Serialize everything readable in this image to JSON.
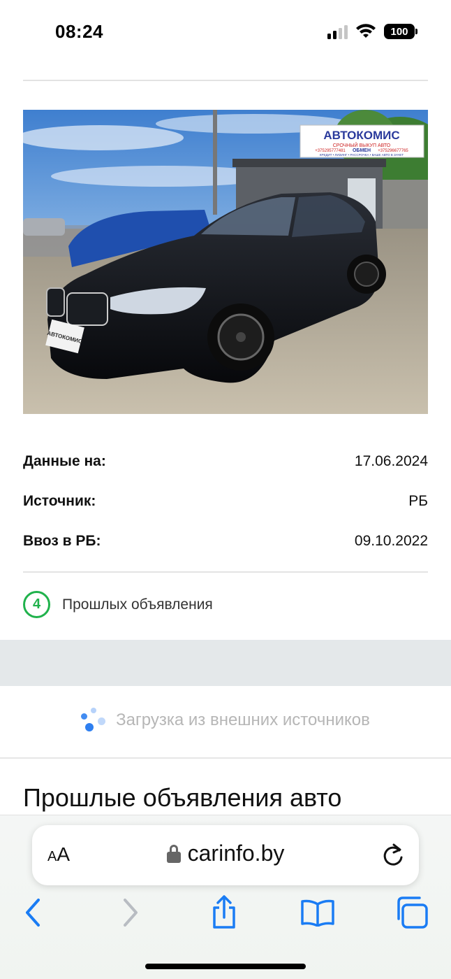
{
  "status_bar": {
    "time": "08:24",
    "battery": "100",
    "icons": [
      "signal-icon",
      "wifi-icon",
      "battery-icon"
    ]
  },
  "photo": {
    "sign_title": "АВТОКОМИС",
    "sign_subtitle": "СРОЧНЫЙ ВЫКУП АВТО",
    "sign_exchange": "ОБМЕН",
    "sign_phone_left": "+375295777481",
    "sign_phone_right": "+375296677765",
    "sign_bottom": "КРЕДИТ • ЛИЗИНГ • РАССРОЧКА • ВАШЕ АВТО В ЗАЧЕТ",
    "plate": "АВТОКОМИС"
  },
  "info": {
    "rows": [
      {
        "label": "Данные на:",
        "value": "17.06.2024"
      },
      {
        "label": "Источник:",
        "value": "РБ"
      },
      {
        "label": "Ввоз в РБ:",
        "value": "09.10.2022"
      }
    ]
  },
  "past_ads": {
    "count": "4",
    "label": "Прошлых объявления"
  },
  "loading": {
    "text": "Загрузка из внешних источников"
  },
  "section": {
    "title": "Прошлые объявления авто"
  },
  "browser": {
    "text_size_label": "AA",
    "url": "carinfo.by",
    "toolbar_icons": [
      "back-icon",
      "forward-icon",
      "share-icon",
      "bookmarks-icon",
      "tabs-icon"
    ]
  },
  "colors": {
    "accent_green": "#20b24c",
    "accent_blue": "#2e7ff0",
    "ios_blue": "#1a7cf4",
    "band_gray": "#e4e8ea"
  }
}
